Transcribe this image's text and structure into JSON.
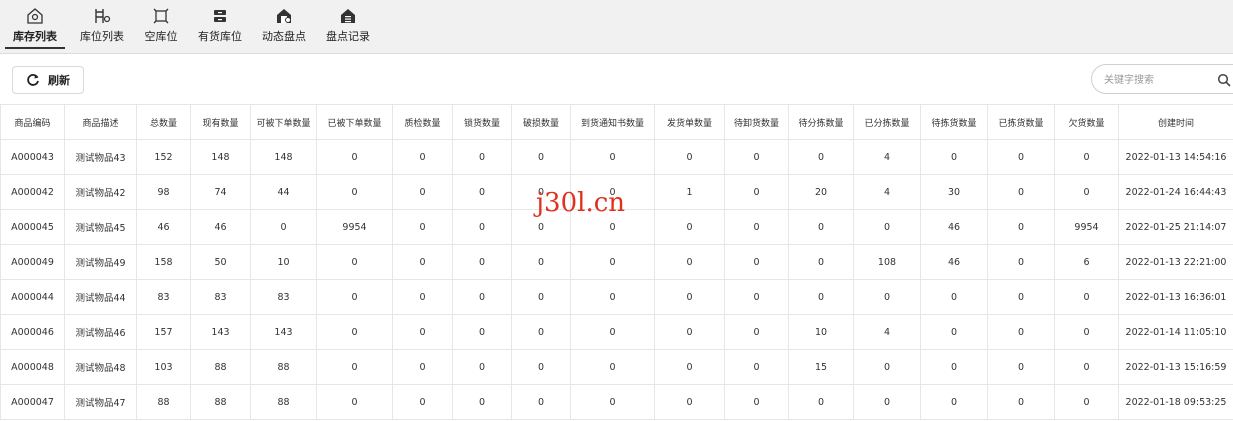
{
  "tabs": [
    {
      "label": "库存列表",
      "icon": "warehouse-icon",
      "active": true
    },
    {
      "label": "库位列表",
      "icon": "shelf-icon",
      "active": false
    },
    {
      "label": "空库位",
      "icon": "empty-location-icon",
      "active": false
    },
    {
      "label": "有货库位",
      "icon": "stocked-location-icon",
      "active": false
    },
    {
      "label": "动态盘点",
      "icon": "dynamic-count-icon",
      "active": false
    },
    {
      "label": "盘点记录",
      "icon": "count-record-icon",
      "active": false
    }
  ],
  "toolbar": {
    "refresh_label": "刷新"
  },
  "search": {
    "placeholder": "关键字搜索"
  },
  "table": {
    "headers": [
      "商品编码",
      "商品描述",
      "总数量",
      "现有数量",
      "可被下单数量",
      "已被下单数量",
      "质检数量",
      "锁货数量",
      "破损数量",
      "到货通知书数量",
      "发货单数量",
      "待卸货数量",
      "待分拣数量",
      "已分拣数量",
      "待拣货数量",
      "已拣货数量",
      "欠货数量",
      "创建时间"
    ],
    "rows": [
      [
        "A000043",
        "测试物品43",
        "152",
        "148",
        "148",
        "0",
        "0",
        "0",
        "0",
        "0",
        "0",
        "0",
        "0",
        "4",
        "0",
        "0",
        "0",
        "2022-01-13 14:54:16"
      ],
      [
        "A000042",
        "测试物品42",
        "98",
        "74",
        "44",
        "0",
        "0",
        "0",
        "0",
        "0",
        "1",
        "0",
        "20",
        "4",
        "30",
        "0",
        "0",
        "2022-01-24 16:44:43"
      ],
      [
        "A000045",
        "测试物品45",
        "46",
        "46",
        "0",
        "9954",
        "0",
        "0",
        "0",
        "0",
        "0",
        "0",
        "0",
        "0",
        "46",
        "0",
        "9954",
        "2022-01-25 21:14:07"
      ],
      [
        "A000049",
        "测试物品49",
        "158",
        "50",
        "10",
        "0",
        "0",
        "0",
        "0",
        "0",
        "0",
        "0",
        "0",
        "108",
        "46",
        "0",
        "6",
        "2022-01-13 22:21:00"
      ],
      [
        "A000044",
        "测试物品44",
        "83",
        "83",
        "83",
        "0",
        "0",
        "0",
        "0",
        "0",
        "0",
        "0",
        "0",
        "0",
        "0",
        "0",
        "0",
        "2022-01-13 16:36:01"
      ],
      [
        "A000046",
        "测试物品46",
        "157",
        "143",
        "143",
        "0",
        "0",
        "0",
        "0",
        "0",
        "0",
        "0",
        "10",
        "4",
        "0",
        "0",
        "0",
        "2022-01-14 11:05:10"
      ],
      [
        "A000048",
        "测试物品48",
        "103",
        "88",
        "88",
        "0",
        "0",
        "0",
        "0",
        "0",
        "0",
        "0",
        "15",
        "0",
        "0",
        "0",
        "0",
        "2022-01-13 15:16:59"
      ],
      [
        "A000047",
        "测试物品47",
        "88",
        "88",
        "88",
        "0",
        "0",
        "0",
        "0",
        "0",
        "0",
        "0",
        "0",
        "0",
        "0",
        "0",
        "0",
        "2022-01-18 09:53:25"
      ]
    ]
  },
  "watermark": "j30l.cn"
}
